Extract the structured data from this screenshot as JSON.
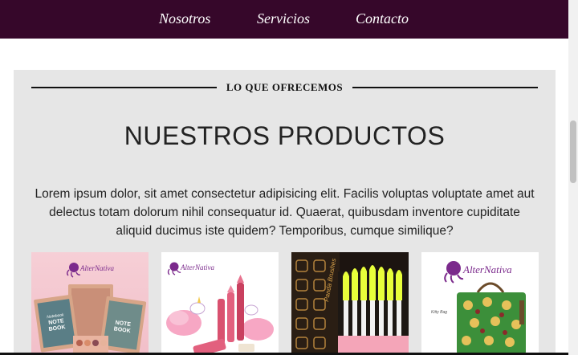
{
  "nav": {
    "items": [
      "Nosotros",
      "Servicios",
      "Contacto"
    ]
  },
  "section": {
    "eyebrow": "LO QUE OFRECEMOS",
    "title": "NUESTROS PRODUCTOS",
    "description": "Lorem ipsum dolor, sit amet consectetur adipisicing elit. Facilis voluptas voluptate amet aut delectus totam dolorum nihil consequatur id. Quaerat, quibusdam inventore cupiditate aliquid ducimus iste quidem? Temporibus, cumque similique?"
  },
  "products": [
    {
      "image": "notebook-eyeshadow-palettes",
      "logo": "AlterNativa",
      "box_text": [
        "Notebook",
        "NOTE",
        "BOOK"
      ]
    },
    {
      "image": "unicorn-lipsticks",
      "logo": "AlterNativa"
    },
    {
      "image": "neon-brush-set",
      "box_text": "Panda Brushes"
    },
    {
      "image": "cat-print-bag",
      "logo": "AlterNativa"
    }
  ],
  "colors": {
    "navbar": "#36072a",
    "section_bg": "#e6e6e6",
    "text": "#222222",
    "logo_purple": "#7b2a8c"
  }
}
